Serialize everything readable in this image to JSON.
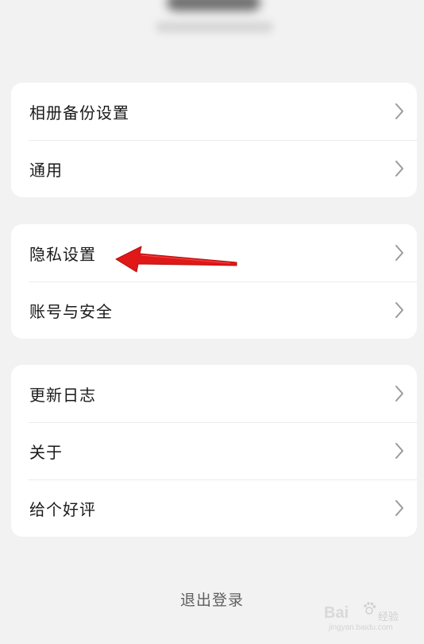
{
  "groups": [
    {
      "items": [
        {
          "label": "相册备份设置"
        },
        {
          "label": "通用"
        }
      ]
    },
    {
      "items": [
        {
          "label": "隐私设置"
        },
        {
          "label": "账号与安全"
        }
      ]
    },
    {
      "items": [
        {
          "label": "更新日志"
        },
        {
          "label": "关于"
        },
        {
          "label": "给个好评"
        }
      ]
    }
  ],
  "logout_label": "退出登录",
  "watermark": {
    "brand": "Bai",
    "brand_cn": "经验",
    "sub": "jingyan.baidu.com"
  },
  "colors": {
    "background": "#f2f2f2",
    "card": "#ffffff",
    "text": "#1a1a1a",
    "chevron": "#9a9a9a",
    "annotation_arrow": "#e01818"
  },
  "icons": {
    "chevron": "chevron-right-icon",
    "annotation": "red-pointer-arrow"
  }
}
